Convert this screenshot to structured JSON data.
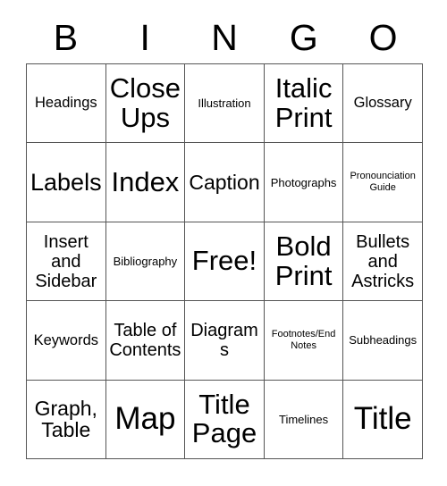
{
  "card": {
    "title": "BINGO",
    "free_space_label": "Free!",
    "border_color": "#555555",
    "text_color": "#000000",
    "background_color": "#ffffff"
  },
  "header": {
    "letters": [
      {
        "label": "B"
      },
      {
        "label": "I"
      },
      {
        "label": "N"
      },
      {
        "label": "G"
      },
      {
        "label": "O"
      }
    ]
  },
  "grid": {
    "columns": 5,
    "rows": 5,
    "cells": [
      [
        {
          "label": "Headings",
          "size": "fs-md"
        },
        {
          "label": "Close\nUps",
          "size": "fs-3xl"
        },
        {
          "label": "Illustration",
          "size": "fs-sm"
        },
        {
          "label": "Italic\nPrint",
          "size": "fs-3xl"
        },
        {
          "label": "Glossary",
          "size": "fs-md"
        }
      ],
      [
        {
          "label": "Labels",
          "size": "fs-2xl"
        },
        {
          "label": "Index",
          "size": "fs-3xl"
        },
        {
          "label": "Caption",
          "size": "fs-xl"
        },
        {
          "label": "Photographs",
          "size": "fs-sm"
        },
        {
          "label": "Pronounciation\nGuide",
          "size": "fs-xs"
        }
      ],
      [
        {
          "label": "Insert\nand\nSidebar",
          "size": "fs-lg"
        },
        {
          "label": "Bibliography",
          "size": "fs-sm"
        },
        {
          "label": "Free!",
          "size": "fs-3xl"
        },
        {
          "label": "Bold\nPrint",
          "size": "fs-3xl"
        },
        {
          "label": "Bullets\nand\nAstricks",
          "size": "fs-lg"
        }
      ],
      [
        {
          "label": "Keywords",
          "size": "fs-md"
        },
        {
          "label": "Table of\nContents",
          "size": "fs-lg"
        },
        {
          "label": "Diagrams",
          "size": "fs-lg"
        },
        {
          "label": "Footnotes/End\nNotes",
          "size": "fs-xs"
        },
        {
          "label": "Subheadings",
          "size": "fs-sm"
        }
      ],
      [
        {
          "label": "Graph,\nTable",
          "size": "fs-xl"
        },
        {
          "label": "Map",
          "size": "fs-4xl"
        },
        {
          "label": "Title\nPage",
          "size": "fs-3xl"
        },
        {
          "label": "Timelines",
          "size": "fs-sm"
        },
        {
          "label": "Title",
          "size": "fs-4xl"
        }
      ]
    ]
  }
}
